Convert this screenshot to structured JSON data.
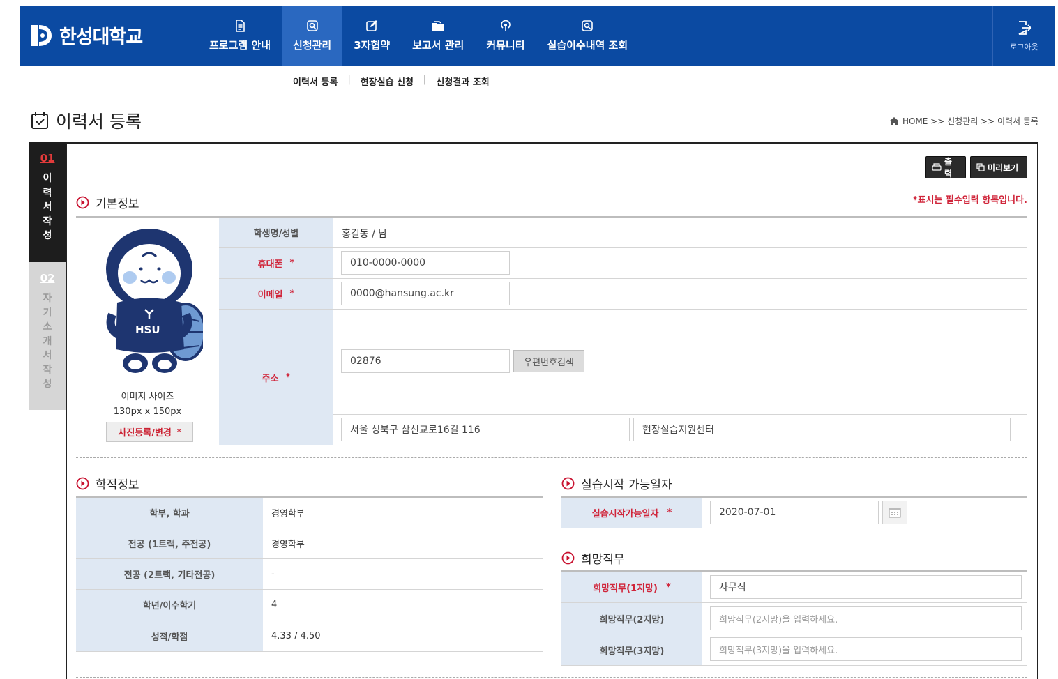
{
  "header": {
    "logo_text": "한성대학교",
    "nav": [
      {
        "label": "프로그램 안내",
        "icon": "document-icon"
      },
      {
        "label": "신청관리",
        "icon": "search-icon",
        "active": true
      },
      {
        "label": "3자협약",
        "icon": "edit-icon"
      },
      {
        "label": "보고서 관리",
        "icon": "folder-icon"
      },
      {
        "label": "커뮤니티",
        "icon": "broadcast-icon"
      },
      {
        "label": "실습이수내역 조회",
        "icon": "search-icon"
      }
    ],
    "logout_label": "로그아웃",
    "brand_color": "#0b4aa2"
  },
  "subnav": {
    "items": [
      "이력서 등록",
      "현장실습 신청",
      "신청결과 조회"
    ]
  },
  "page": {
    "title": "이력서 등록",
    "breadcrumb": "HOME >> 신청관리 >> 이력서 등록"
  },
  "steps": [
    {
      "num": "01",
      "text": "이\n력\n서\n작\n성"
    },
    {
      "num": "02",
      "text": "자\n기\n소\n개\n서\n작\n성"
    }
  ],
  "actions": {
    "print_label": "출력",
    "preview_label": "미리보기"
  },
  "required_note": "*표시는 필수입력 항목입니다.",
  "basic": {
    "section_title": "기본정보",
    "image_size_line1": "이미지 사이즈",
    "image_size_line2": "130px x 150px",
    "photo_button": "사진등록/변경",
    "labels": {
      "name_gender": "학생명/성별",
      "phone": "휴대폰",
      "email": "이메일",
      "address": "주소"
    },
    "name_gender_value": "홍길동 / 남",
    "phone_value": "010-0000-0000",
    "email_value": "0000@hansung.ac.kr",
    "zipcode_value": "02876",
    "zip_search_button": "우편번호검색",
    "address1_value": "서울 성북구 삼선교로16길 116",
    "address2_value": "현장실습지원센터"
  },
  "academic": {
    "section_title": "학적정보",
    "rows": [
      {
        "label": "학부, 학과",
        "value": "경영학부"
      },
      {
        "label": "전공 (1트랙, 주전공)",
        "value": "경영학부"
      },
      {
        "label": "전공 (2트랙, 기타전공)",
        "value": "-"
      },
      {
        "label": "학년/이수학기",
        "value": "4"
      },
      {
        "label": "성적/학점",
        "value": "4.33 / 4.50"
      }
    ]
  },
  "start_date": {
    "section_title": "실습시작 가능일자",
    "label": "실습시작가능일자",
    "value": "2020-07-01"
  },
  "desired_job": {
    "section_title": "희망직무",
    "rows": [
      {
        "label": "희망직무(1지망)",
        "value": "사무직",
        "placeholder": ""
      },
      {
        "label": "희망직무(2지망)",
        "value": "",
        "placeholder": "희망직무(2지망)을 입력하세요."
      },
      {
        "label": "희망직무(3지망)",
        "value": "",
        "placeholder": "희망직무(3지망)을 입력하세요."
      }
    ]
  },
  "required_mark": "*"
}
